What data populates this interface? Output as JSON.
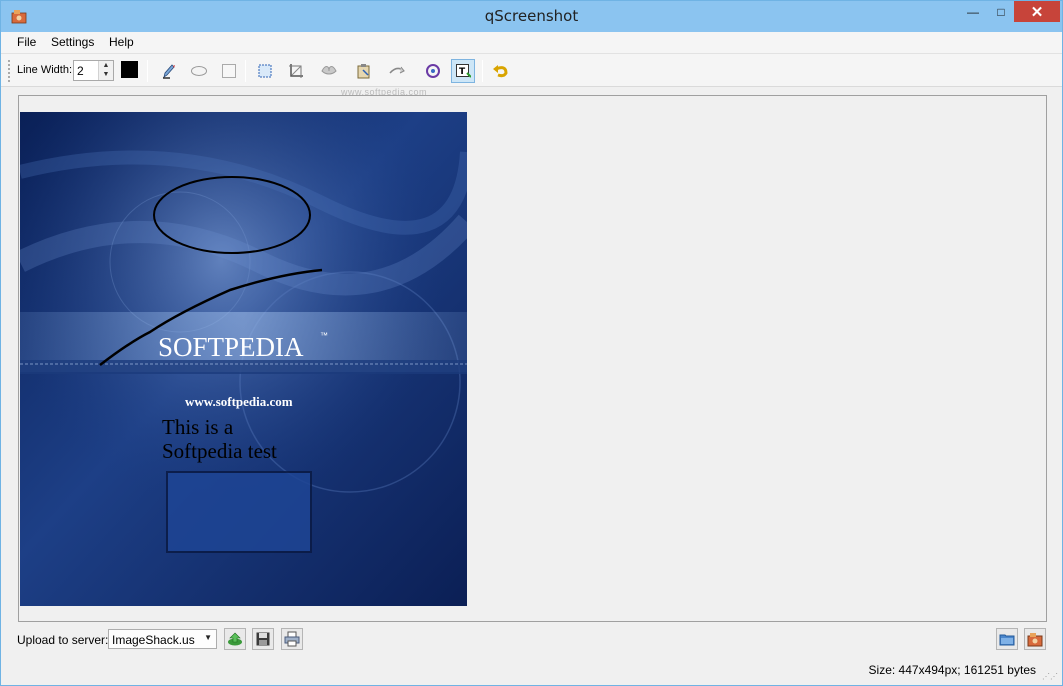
{
  "window": {
    "title": "qScreenshot",
    "close_glyph": "✕",
    "minimize_glyph": "—",
    "maximize_glyph": "□"
  },
  "menu": {
    "items": [
      "File",
      "Settings",
      "Help"
    ]
  },
  "toolbar": {
    "line_width_label": "Line Width:",
    "line_width_value": "2",
    "color": "#000000",
    "tools": [
      "pencil-icon",
      "ellipse-icon",
      "rectangle-icon",
      "select-area-icon",
      "crop-icon",
      "blur-icon",
      "paste-icon",
      "arrow-icon",
      "rotate-icon",
      "text-icon",
      "undo-icon"
    ],
    "active_tool": "text-icon"
  },
  "watermark": "www.softpedia.com",
  "screenshot": {
    "brand": "SOFTPEDIA",
    "trademark": "™",
    "url": "www.softpedia.com",
    "annotation_text_line1": "This is a",
    "annotation_text_line2": "Softpedia test"
  },
  "bottom": {
    "upload_label": "Upload to server:",
    "server_selected": "ImageShack.us",
    "buttons": [
      "upload-icon",
      "save-icon",
      "print-icon"
    ],
    "right_buttons": [
      "open-folder-icon",
      "capture-icon"
    ]
  },
  "status": {
    "size_text": "Size: 447x494px; 161251 bytes"
  },
  "colors": {
    "titlebar": "#8bc4f0",
    "close": "#c7443a",
    "active_tool": "#cde6f7",
    "screenshot_bg": "#1a3a7a"
  }
}
